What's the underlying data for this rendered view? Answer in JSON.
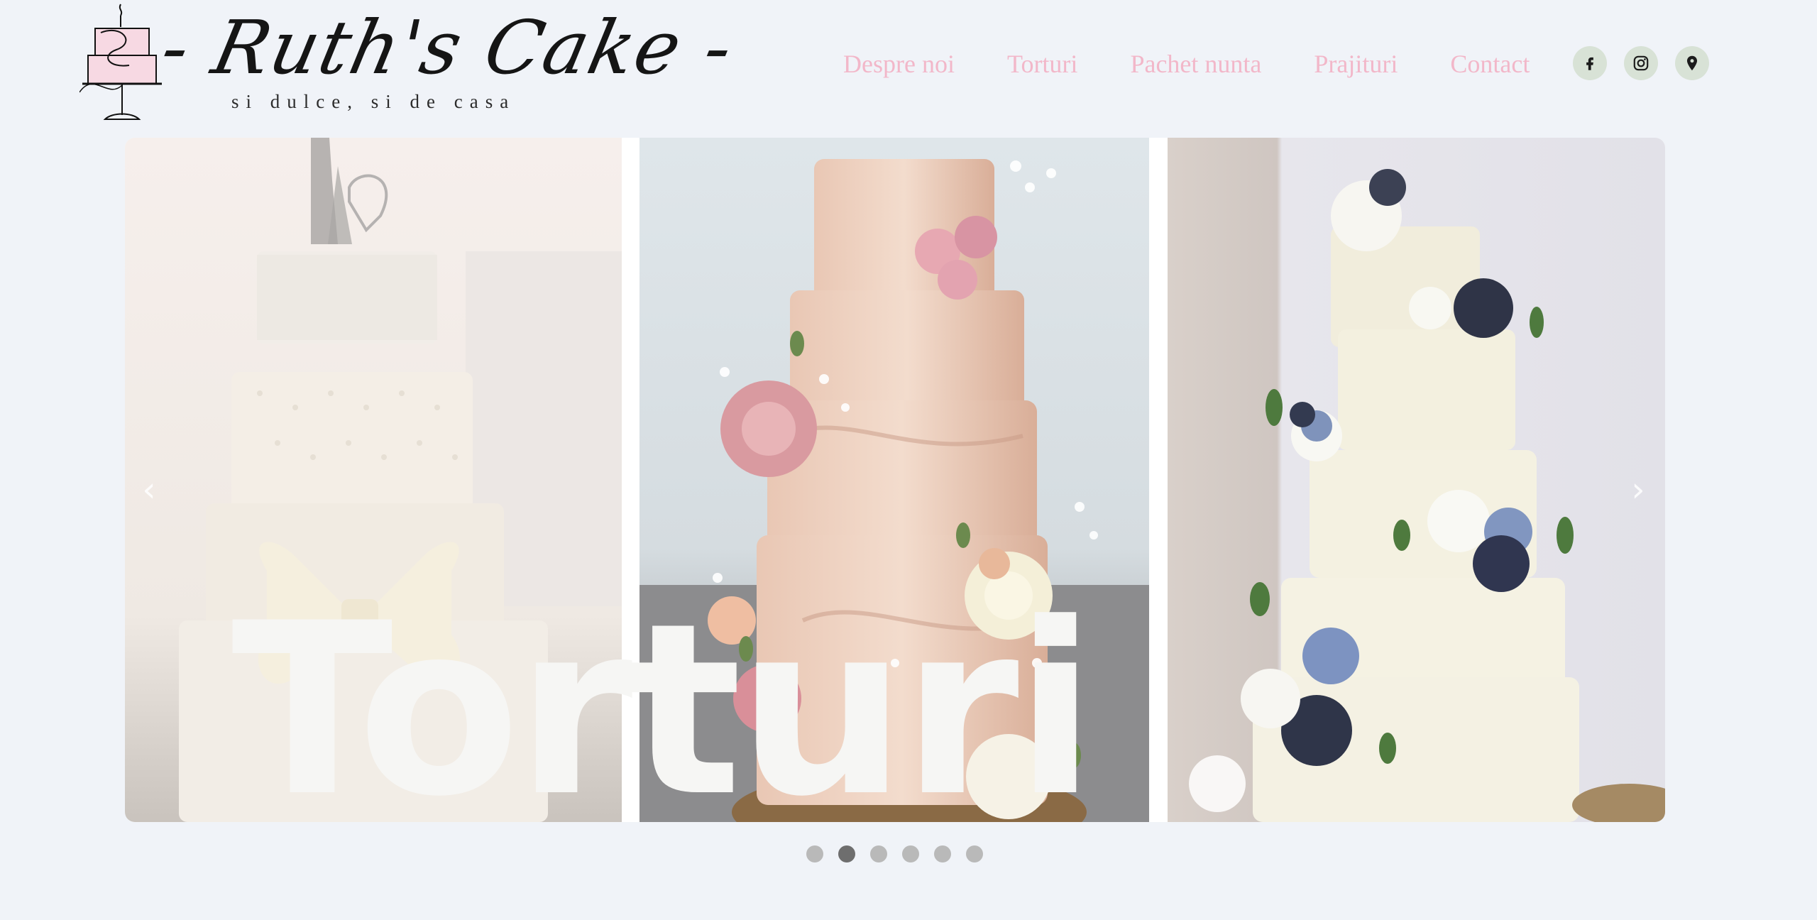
{
  "brand": {
    "title": "- Ruth's Cake -",
    "tagline": "si dulce, si de casa",
    "logo_icon": "cake-stand-icon"
  },
  "nav": {
    "items": [
      {
        "label": "Despre noi"
      },
      {
        "label": "Torturi"
      },
      {
        "label": "Pachet nunta"
      },
      {
        "label": "Prajituri"
      },
      {
        "label": "Contact"
      }
    ],
    "color": "#f2b7c9"
  },
  "social": {
    "icons": [
      "facebook-icon",
      "instagram-icon",
      "map-pin-icon"
    ],
    "background": "#d8e2d6"
  },
  "carousel": {
    "heading": "Torturi",
    "prev_arrow": "‹",
    "next_arrow": "›",
    "slide_count": 6,
    "active_index": 1,
    "slides": [
      {
        "name": "white-cake-with-bow-and-topper"
      },
      {
        "name": "blush-marble-cake-with-roses"
      },
      {
        "name": "ivory-cake-with-navy-and-blue-flowers"
      }
    ]
  },
  "colors": {
    "page_background": "#f0f3f8",
    "dot_inactive": "#b9b9b9",
    "dot_active": "#6e6e6e"
  }
}
